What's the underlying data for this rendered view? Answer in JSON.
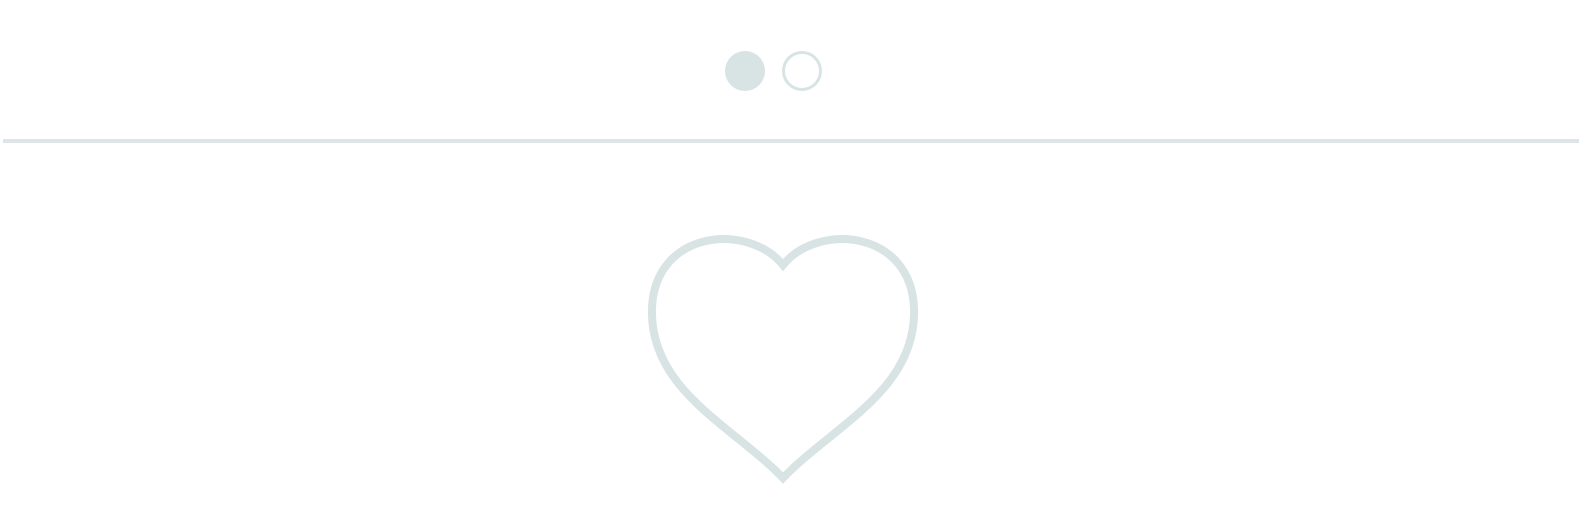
{
  "colors": {
    "accent": "#d8e3e4",
    "line": "#dde5e6",
    "background": "#ffffff"
  },
  "pager": {
    "pages": [
      {
        "state": "active"
      },
      {
        "state": "inactive"
      }
    ]
  },
  "content": {
    "icon": "heart-outline-icon"
  }
}
